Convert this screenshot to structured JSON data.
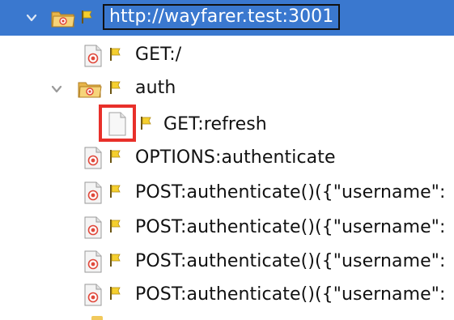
{
  "tree": {
    "root": {
      "label": "http://wayfarer.test:3001",
      "icon": "folder-icon",
      "flag": "flag-icon",
      "expanded": true,
      "selected": true
    },
    "items": [
      {
        "label": "GET:/",
        "icon": "request-icon",
        "flag": "flag-icon"
      },
      {
        "label": "auth",
        "icon": "folder-icon",
        "flag": "flag-icon",
        "expanded": true
      },
      {
        "label": "GET:refresh",
        "icon": "blank-document-icon",
        "flag": "flag-icon",
        "highlighted": true
      },
      {
        "label": "OPTIONS:authenticate",
        "icon": "request-icon",
        "flag": "flag-icon"
      },
      {
        "label": "POST:authenticate()({\"username\":",
        "icon": "request-icon",
        "flag": "flag-icon"
      },
      {
        "label": "POST:authenticate()({\"username\":",
        "icon": "request-icon",
        "flag": "flag-icon"
      },
      {
        "label": "POST:authenticate()({\"username\":",
        "icon": "request-icon",
        "flag": "flag-icon"
      },
      {
        "label": "POST:authenticate()({\"username\":",
        "icon": "request-icon",
        "flag": "flag-icon"
      }
    ]
  },
  "colors": {
    "selection": "#3a78cf",
    "highlight_box": "#e8302a",
    "flag": "#e0b41a",
    "target": "#e0493c",
    "folder": "#f1c95c"
  }
}
